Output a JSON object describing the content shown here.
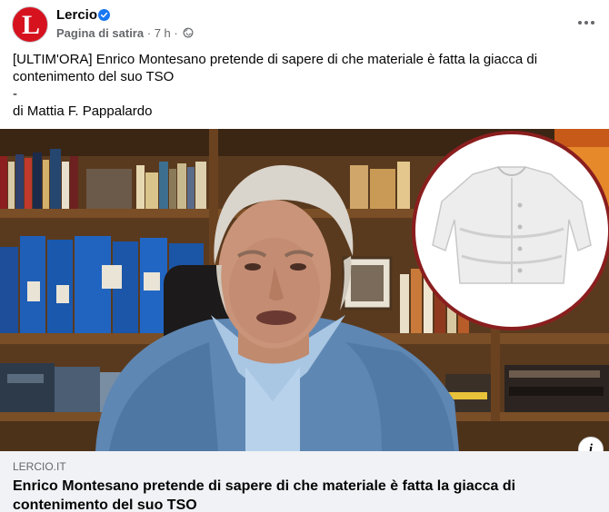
{
  "post": {
    "author": "Lercio",
    "avatar_letter": "L",
    "category": "Pagina di satira",
    "time": "7 h",
    "separator": "·",
    "caption_lines": [
      "[ULTIM'ORA] Enrico Montesano pretende di sapere di che materiale è fatta la giacca di",
      "contenimento del suo TSO",
      "-",
      "di Mattia F. Pappalardo"
    ]
  },
  "link": {
    "domain": "LERCIO.IT",
    "title": "Enrico Montesano pretende di sapere di che materiale è fatta la giacca di contenimento del suo TSO"
  },
  "icons": {
    "verified": "verified-badge-icon",
    "audience": "globe-icon",
    "more": "more-options-icon",
    "info": "info-icon"
  },
  "colors": {
    "brand": "#d6121f",
    "verified": "#1877f2",
    "secondary_text": "#65676b",
    "link_bg": "#f0f2f5"
  }
}
